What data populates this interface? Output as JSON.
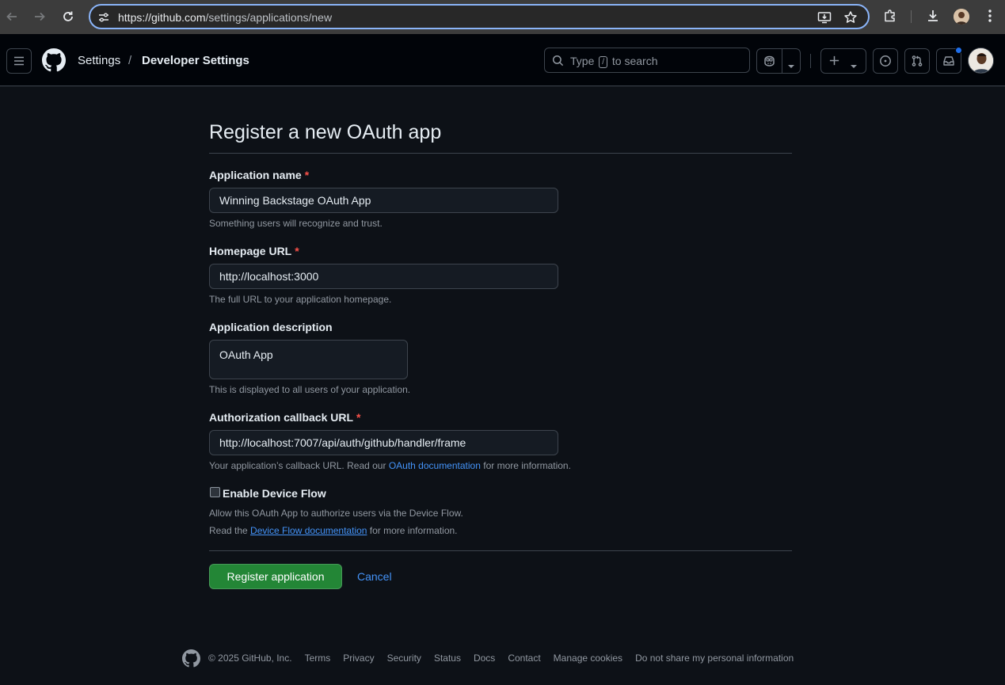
{
  "browser": {
    "url_host": "https://github.com",
    "url_path": "/settings/applications/new",
    "icons": [
      "back-icon",
      "forward-icon",
      "reload-icon",
      "site-settings-icon",
      "install-app-icon",
      "bookmark-star-icon",
      "extensions-icon",
      "downloads-icon",
      "profile-icon",
      "menu-kebab-icon"
    ]
  },
  "header": {
    "breadcrumb": [
      "Settings",
      "Developer Settings"
    ],
    "breadcrumb_separator": "/",
    "search_prefix": "Type",
    "search_key": "/",
    "search_suffix": "to search",
    "icons": [
      "hamburger-icon",
      "github-logo-icon",
      "search-icon",
      "copilot-icon",
      "chevron-down-icon",
      "plus-icon",
      "issues-icon",
      "pull-requests-icon",
      "inbox-icon",
      "avatar"
    ]
  },
  "form": {
    "title": "Register a new OAuth app",
    "app_name": {
      "label": "Application name",
      "required_mark": "*",
      "value": "Winning Backstage OAuth App",
      "hint": "Something users will recognize and trust."
    },
    "homepage": {
      "label": "Homepage URL",
      "required_mark": "*",
      "value": "http://localhost:3000",
      "hint": "The full URL to your application homepage."
    },
    "description": {
      "label": "Application description",
      "value": "OAuth App",
      "hint": "This is displayed to all users of your application."
    },
    "callback": {
      "label": "Authorization callback URL",
      "required_mark": "*",
      "value": "http://localhost:7007/api/auth/github/handler/frame",
      "hint_before": "Your application’s callback URL. Read our",
      "hint_link": "OAuth documentation",
      "hint_after": "for more information."
    },
    "device_flow": {
      "label": "Enable Device Flow",
      "checked": false,
      "hint1": "Allow this OAuth App to authorize users via the Device Flow.",
      "hint2_before": "Read the",
      "hint2_link": "Device Flow documentation",
      "hint2_after": "for more information."
    },
    "submit_label": "Register application",
    "cancel_label": "Cancel"
  },
  "footer": {
    "copyright": "© 2025 GitHub, Inc.",
    "links": [
      "Terms",
      "Privacy",
      "Security",
      "Status",
      "Docs",
      "Contact",
      "Manage cookies",
      "Do not share my personal information"
    ]
  },
  "colors": {
    "page_bg": "#0d1117",
    "header_bg": "#010409",
    "primary_button": "#238636",
    "link": "#4493f8",
    "required": "#f85149"
  }
}
